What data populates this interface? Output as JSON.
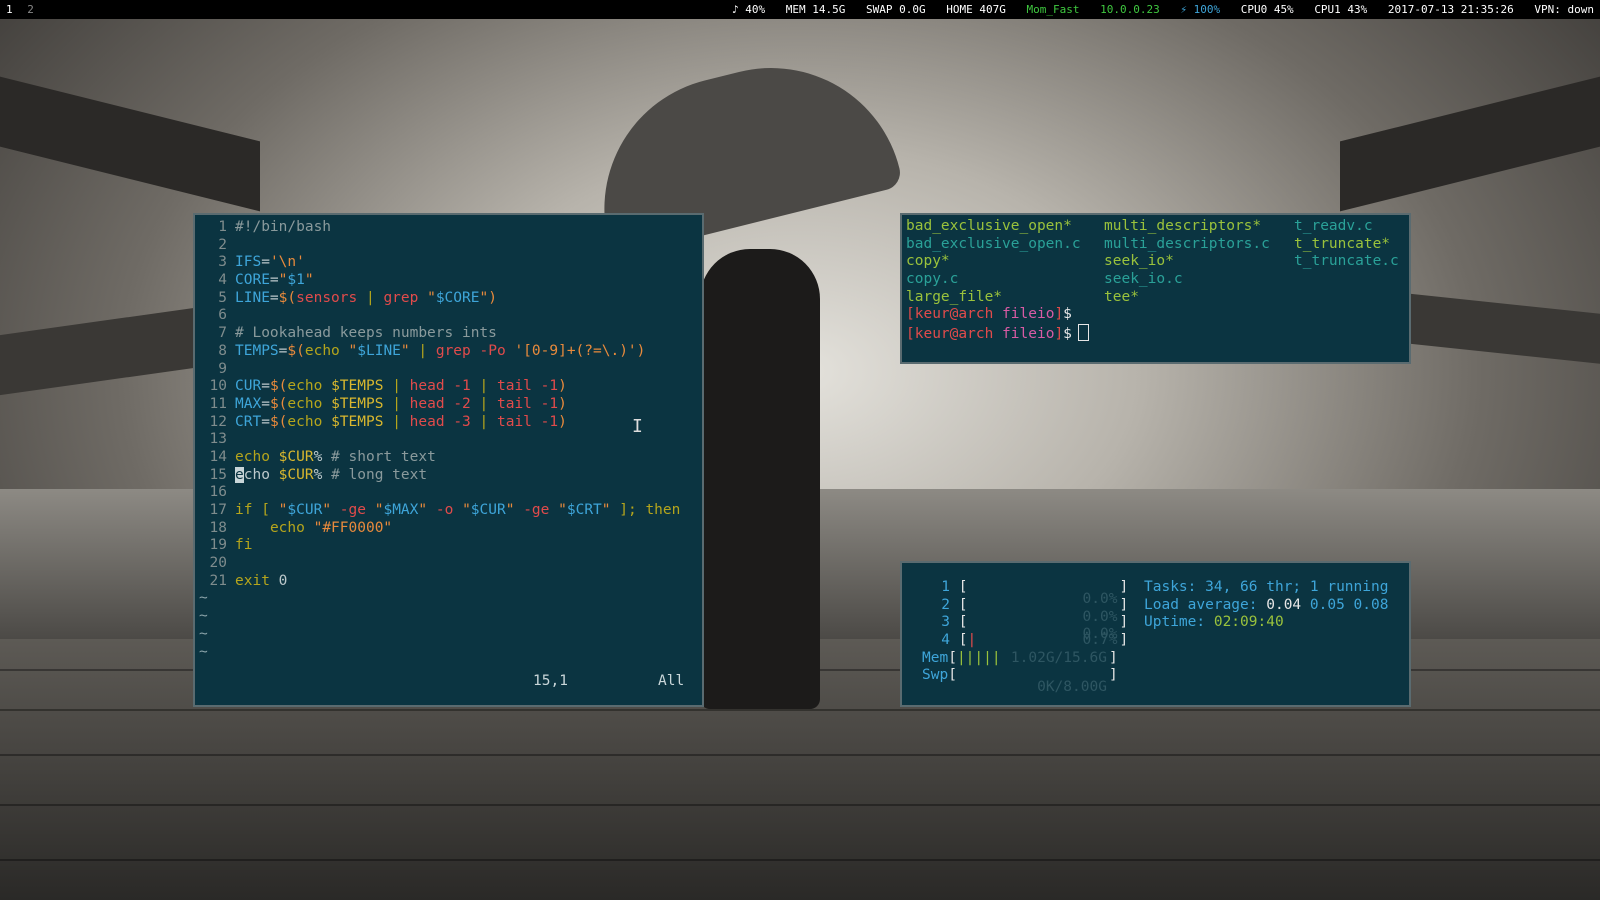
{
  "topbar": {
    "workspaces": [
      "1",
      "2"
    ],
    "status": {
      "volume": "♪ 40%",
      "mem": "MEM 14.5G",
      "swap": "SWAP 0.0G",
      "home": "HOME 407G",
      "wifi": "Mom_Fast",
      "ip": "10.0.0.23",
      "battery": "⚡ 100%",
      "cpu0": "CPU0 45%",
      "cpu1": "CPU1 43%",
      "datetime": "2017-07-13 21:35:26",
      "vpn": "VPN: down"
    },
    "colors": {
      "wifi": "#3fc83f",
      "ip": "#3fc83f",
      "battery": "#3ea5d9"
    }
  },
  "vim": {
    "lines": [
      {
        "n": "1",
        "t": "#!/bin/bash"
      },
      {
        "n": "2",
        "t": ""
      },
      {
        "n": "3",
        "t": "IFS='\\n'"
      },
      {
        "n": "4",
        "t": "CORE=\"$1\""
      },
      {
        "n": "5",
        "t": "LINE=$(sensors | grep \"$CORE\")"
      },
      {
        "n": "6",
        "t": ""
      },
      {
        "n": "7",
        "t": "# Lookahead keeps numbers ints"
      },
      {
        "n": "8",
        "t": "TEMPS=$(echo \"$LINE\" | grep -Po '[0-9]+(?=\\.)')"
      },
      {
        "n": "9",
        "t": ""
      },
      {
        "n": "10",
        "t": "CUR=$(echo $TEMPS | head -1 | tail -1)"
      },
      {
        "n": "11",
        "t": "MAX=$(echo $TEMPS | head -2 | tail -1)"
      },
      {
        "n": "12",
        "t": "CRT=$(echo $TEMPS | head -3 | tail -1)"
      },
      {
        "n": "13",
        "t": ""
      },
      {
        "n": "14",
        "t": "echo $CUR% # short text"
      },
      {
        "n": "15",
        "t": "echo $CUR% # long text"
      },
      {
        "n": "16",
        "t": ""
      },
      {
        "n": "17",
        "t": "if [ \"$CUR\" -ge \"$MAX\" -o \"$CUR\" -ge \"$CRT\" ]; then"
      },
      {
        "n": "18",
        "t": "    echo \"#FF0000\""
      },
      {
        "n": "19",
        "t": "fi"
      },
      {
        "n": "20",
        "t": ""
      },
      {
        "n": "21",
        "t": "exit 0"
      }
    ],
    "tilde_rows": [
      "~",
      "~",
      "~",
      "~"
    ],
    "cursor_position": "15,1",
    "scroll_indicator": "All"
  },
  "ls": {
    "col1": [
      {
        "name": "bad_exclusive_open*",
        "kind": "exec"
      },
      {
        "name": "bad_exclusive_open.c",
        "kind": "file"
      },
      {
        "name": "copy*",
        "kind": "exec"
      },
      {
        "name": "copy.c",
        "kind": "file"
      },
      {
        "name": "large_file*",
        "kind": "exec"
      }
    ],
    "col2": [
      {
        "name": "multi_descriptors*",
        "kind": "exec"
      },
      {
        "name": "multi_descriptors.c",
        "kind": "file"
      },
      {
        "name": "seek_io*",
        "kind": "exec"
      },
      {
        "name": "seek_io.c",
        "kind": "file"
      },
      {
        "name": "tee*",
        "kind": "exec"
      }
    ],
    "col3": [
      {
        "name": "t_readv.c",
        "kind": "file"
      },
      {
        "name": "t_truncate*",
        "kind": "exec"
      },
      {
        "name": "t_truncate.c",
        "kind": "file"
      }
    ],
    "prompt": {
      "open": "[",
      "user_host": "keur@arch",
      "dir": "fileio",
      "close": "]",
      "dollar": "$"
    }
  },
  "htop": {
    "cpus": [
      {
        "num": "1",
        "value": "0.0%",
        "fill": 0.0
      },
      {
        "num": "2",
        "value": "0.0%",
        "fill": 0.0
      },
      {
        "num": "3",
        "value": "0.0%",
        "fill": 0.0
      },
      {
        "num": "4",
        "value": "0.7%",
        "fill": 0.01
      }
    ],
    "mem": {
      "label": "Mem",
      "bars": "|||||",
      "value": "1.02G/15.6G",
      "fill": 0.065
    },
    "swp": {
      "label": "Swp",
      "value": "0K/8.00G",
      "fill": 0.0
    },
    "tasks_label": "Tasks:",
    "tasks_value": "34, 66 thr; 1 running",
    "load_label": "Load average:",
    "load_1": "0.04",
    "load_5": "0.05",
    "load_15": "0.08",
    "uptime_label": "Uptime:",
    "uptime_value": "02:09:40"
  }
}
